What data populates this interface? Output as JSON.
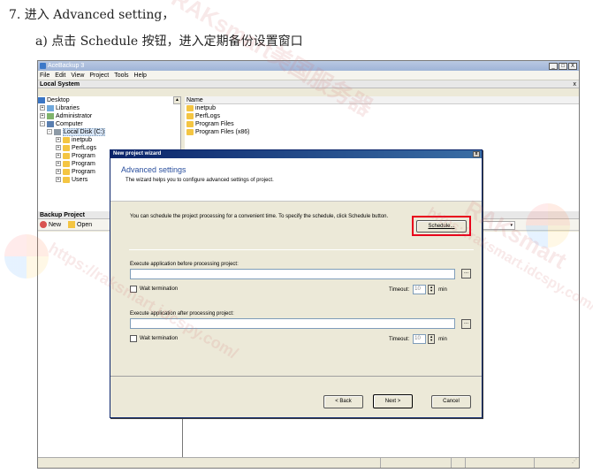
{
  "doc": {
    "step": "7.  进入 Advanced setting，",
    "substep": "a)    点击 Schedule 按钮，进入定期备份设置窗口"
  },
  "watermarks": [
    "RAKsmart美国服务器",
    "https://raksmart.idcspy.com/",
    "RAKsmart",
    "https://raksmart.idcspy.com/"
  ],
  "app": {
    "title": "AceBackup 3",
    "window_buttons": [
      "_",
      "□",
      "X"
    ],
    "menu": [
      "File",
      "Edit",
      "View",
      "Project",
      "Tools",
      "Help"
    ],
    "local_system": {
      "header": "Local System",
      "close": "x",
      "tree": [
        {
          "label": "Desktop",
          "icon": "desktop-icon"
        },
        {
          "label": "Libraries",
          "icon": "libraries-icon"
        },
        {
          "label": "Administrator",
          "icon": "user-icon"
        },
        {
          "label": "Computer",
          "icon": "computer-icon"
        },
        {
          "label": "Local Disk (C:)",
          "icon": "disk-icon"
        },
        {
          "label": "inetpub",
          "icon": "folder-icon"
        },
        {
          "label": "PerfLogs",
          "icon": "folder-icon"
        },
        {
          "label": "Program",
          "icon": "folder-icon"
        },
        {
          "label": "Program",
          "icon": "folder-icon"
        },
        {
          "label": "Program",
          "icon": "folder-icon"
        },
        {
          "label": "Users",
          "icon": "folder-icon"
        }
      ],
      "list_header": "Name",
      "list_items": [
        "inetpub",
        "PerfLogs",
        "Program Files",
        "Program Files (x86)"
      ]
    },
    "backup_project": {
      "header": "Backup Project",
      "new_label": "New",
      "open_label": "Open"
    }
  },
  "dialog": {
    "title": "New project wizard",
    "heading": "Advanced settings",
    "subheading": "The wizard helps you to configure advanced settings of project.",
    "description": "You can schedule the project processing for a convenient time. To specify the schedule, click Schedule button.",
    "schedule_button": "Schedule...",
    "before_label": "Execute application before processing project:",
    "before_value": "",
    "after_label": "Execute application after processing project:",
    "after_value": "",
    "browse": "...",
    "wait_label": "Wait termination",
    "timeout_label": "Timeout:",
    "timeout_before": "10",
    "timeout_after": "10",
    "min_label": "min",
    "back_button": "< Back",
    "next_button": "Next >",
    "cancel_button": "Cancel",
    "close": "x"
  },
  "colors": {
    "highlight": "#e8001c",
    "heading": "#2a4f9e",
    "title_bar": "#0a246a"
  }
}
